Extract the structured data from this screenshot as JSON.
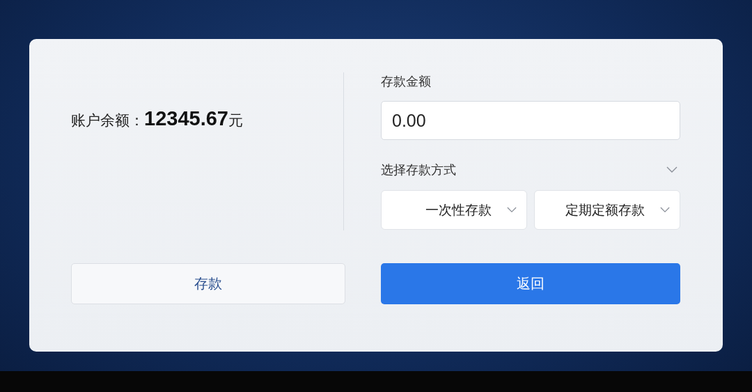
{
  "balance": {
    "text": "账户余额：**12345.67**元"
  },
  "amount": {
    "label": "存款金额",
    "value": "0.00"
  },
  "method": {
    "label": "选择存款方式",
    "expanded": false,
    "selects": [
      {
        "value": "一次性存款"
      },
      {
        "value": "定期定额存款"
      }
    ]
  },
  "buttons": [
    {
      "label": "存款",
      "kind": "secondary"
    },
    {
      "label": "返回",
      "kind": "primary"
    }
  ]
}
